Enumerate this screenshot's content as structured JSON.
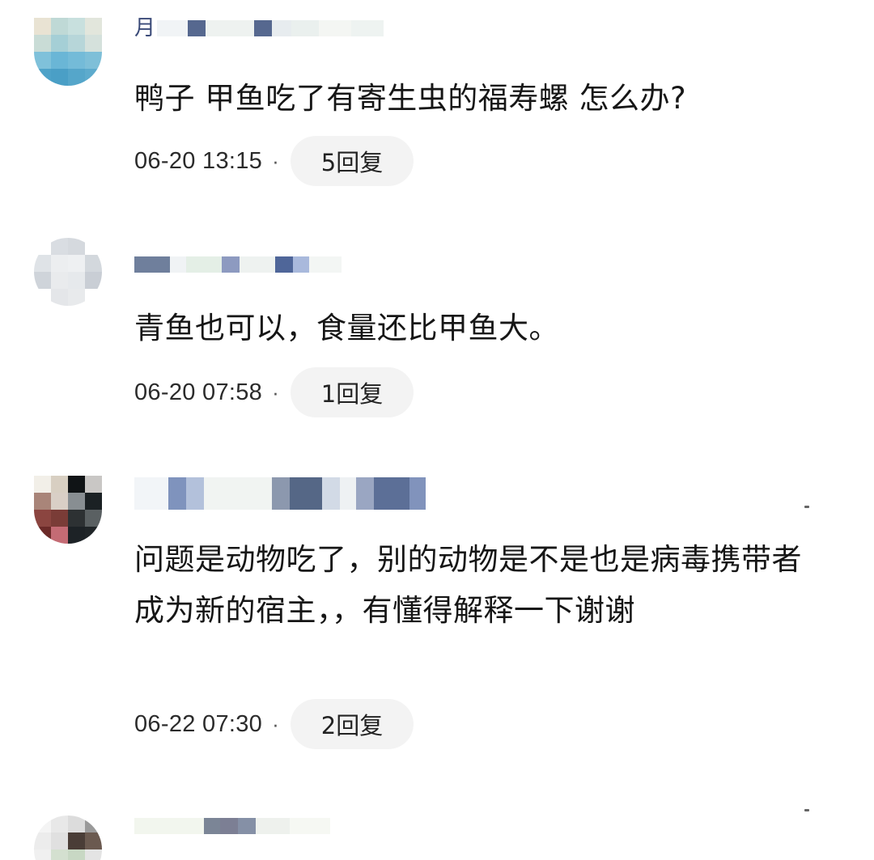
{
  "comments": [
    {
      "username_visible": "月",
      "text": "鸭子 甲鱼吃了有寄生虫的福寿螺 怎么办?",
      "timestamp": "06-20 13:15",
      "separator": "·",
      "reply_label": "5回复"
    },
    {
      "username_visible": "",
      "text": "青鱼也可以，食量还比甲鱼大。",
      "timestamp": "06-20 07:58",
      "separator": "·",
      "reply_label": "1回复"
    },
    {
      "username_visible": "",
      "text": "问题是动物吃了，别的动物是不是也是病毒携带者成为新的宿主，，有懂得解释一下谢谢",
      "timestamp": "06-22 07:30",
      "separator": "·",
      "reply_label": "2回复"
    },
    {
      "username_visible": "",
      "text": "",
      "timestamp": "",
      "separator": "",
      "reply_label": ""
    }
  ],
  "colors": {
    "reply_pill_bg": "#f3f3f3",
    "body_text": "#161616",
    "meta_text": "#2b2b2b",
    "page_bg": "#ffffff"
  }
}
